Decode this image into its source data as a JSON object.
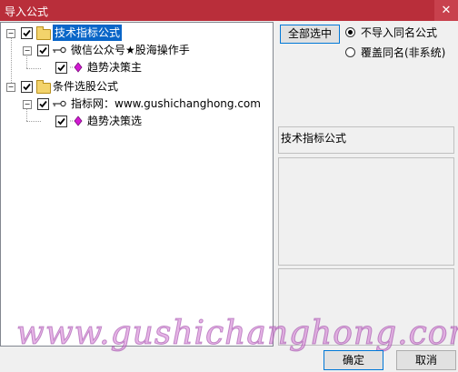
{
  "window": {
    "title": "导入公式",
    "close_glyph": "✕"
  },
  "tree": {
    "expander_minus": "−",
    "nodes": [
      {
        "label": "技术指标公式",
        "checked": true,
        "icon": "folder-icon",
        "selected": true
      },
      {
        "label": "微信公众号★股海操作手",
        "checked": true,
        "icon": "key-icon"
      },
      {
        "label": "趋势决策主",
        "checked": true,
        "icon": "gem-icon"
      },
      {
        "label": "条件选股公式",
        "checked": true,
        "icon": "folder-icon"
      },
      {
        "label": "指标网：www.gushichanghong.com",
        "checked": true,
        "icon": "key-icon"
      },
      {
        "label": "趋势决策选",
        "checked": true,
        "icon": "gem-icon"
      }
    ]
  },
  "options": {
    "select_all_label": "全部选中",
    "radio_no_import": "不导入同名公式",
    "radio_overwrite": "覆盖同名(非系统)",
    "selected_radio": "radio_no_import"
  },
  "info": {
    "title": "技术指标公式"
  },
  "watermark": "www.gushichanghong.com",
  "footer": {
    "ok_label": "确定",
    "cancel_label": "取消"
  },
  "colors": {
    "titlebar": "#b92e3a",
    "selection": "#0a66c8",
    "watermark": "#d278d2"
  }
}
